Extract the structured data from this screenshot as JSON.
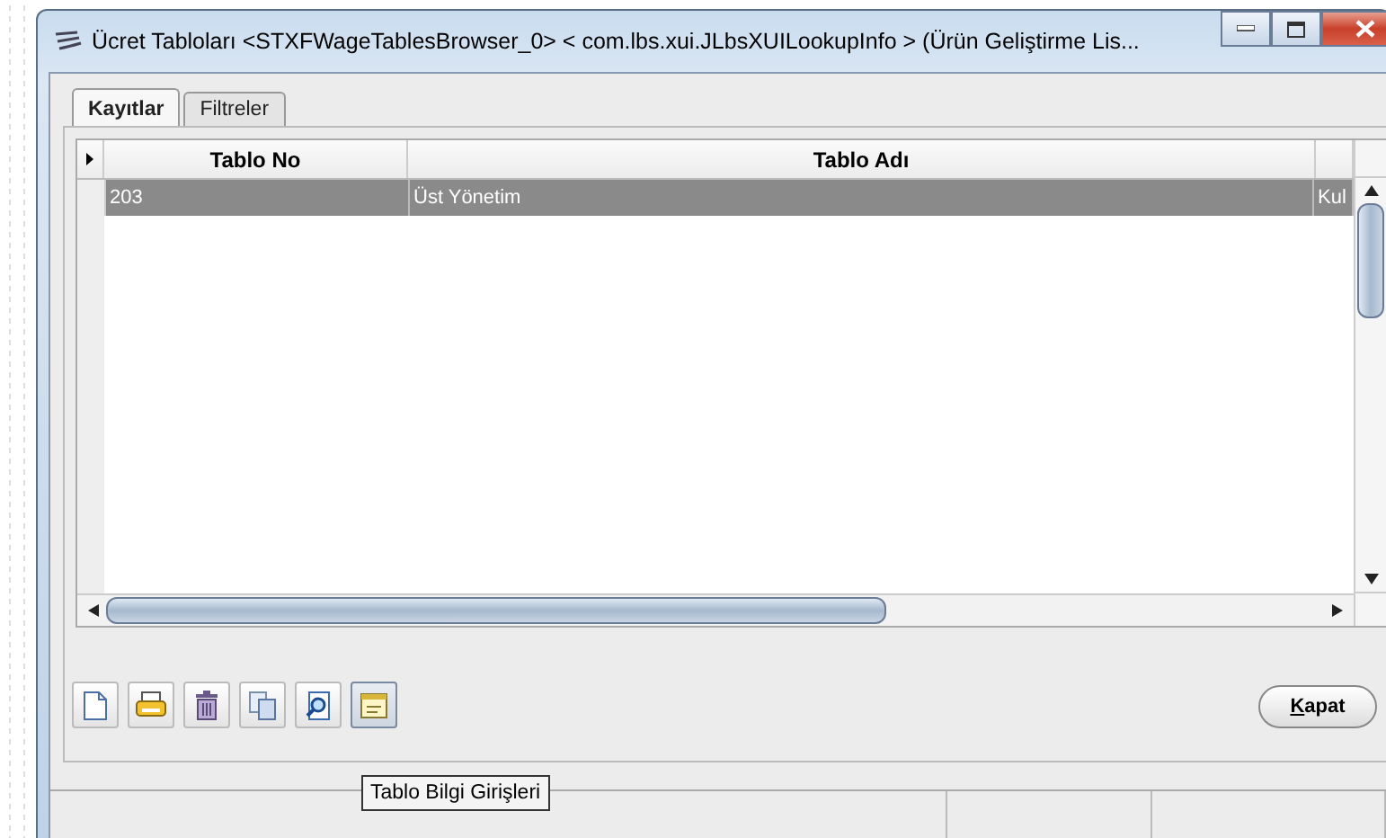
{
  "window": {
    "title": "Ücret Tabloları <STXFWageTablesBrowser_0> < com.lbs.xui.JLbsXUILookupInfo > (Ürün Geliştirme Lis..."
  },
  "tabs": [
    {
      "label": "Kayıtlar",
      "selected": true
    },
    {
      "label": "Filtreler",
      "selected": false
    }
  ],
  "table": {
    "columns": [
      "Tablo No",
      "Tablo Adı"
    ],
    "rows": [
      {
        "cells": [
          "203",
          "Üst Yönetim",
          "Kul"
        ],
        "selected": true
      }
    ]
  },
  "toolbar": [
    {
      "kind": "new",
      "hovered": false
    },
    {
      "kind": "open",
      "hovered": false
    },
    {
      "kind": "delete",
      "hovered": false
    },
    {
      "kind": "copy",
      "hovered": false
    },
    {
      "kind": "inspect",
      "hovered": false
    },
    {
      "kind": "info",
      "hovered": true
    }
  ],
  "tooltip": "Tablo Bilgi Girişleri",
  "close_button": {
    "label": "Kapat"
  }
}
